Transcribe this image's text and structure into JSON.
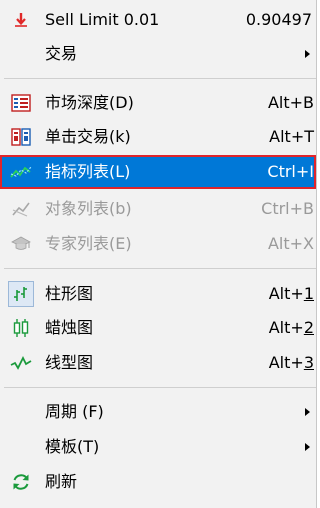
{
  "menu": {
    "items": [
      {
        "label": "Sell Limit 0.01",
        "shortcut": "0.90497"
      },
      {
        "label": "交易",
        "shortcut": ""
      },
      {
        "label": "市场深度(D)",
        "shortcut": "Alt+B"
      },
      {
        "label": "单击交易(k)",
        "shortcut": "Alt+T"
      },
      {
        "label": "指标列表(L)",
        "shortcut": "Ctrl+I"
      },
      {
        "label": "对象列表(b)",
        "shortcut": "Ctrl+B"
      },
      {
        "label": "专家列表(E)",
        "shortcut": "Alt+X"
      },
      {
        "label": "柱形图",
        "shortcut_prefix": "Alt+",
        "shortcut_key": "1"
      },
      {
        "label": "蜡烛图",
        "shortcut_prefix": "Alt+",
        "shortcut_key": "2"
      },
      {
        "label": "线型图",
        "shortcut_prefix": "Alt+",
        "shortcut_key": "3"
      },
      {
        "label": "周期 (F)",
        "shortcut": ""
      },
      {
        "label": "模板(T)",
        "shortcut": ""
      },
      {
        "label": "刷新",
        "shortcut": ""
      }
    ]
  },
  "colors": {
    "selection": "#0078d7",
    "selection_border": "#e0252b",
    "accent_red": "#e02828",
    "accent_green": "#1b9a3c",
    "disabled": "#9a9a9a"
  },
  "icons": {
    "sell_limit": "sell-arrow-icon",
    "market_depth": "market-depth-icon",
    "one_click": "one-click-trading-icon",
    "indicators": "indicator-line-icon",
    "objects": "object-list-icon",
    "experts": "expert-hat-icon",
    "bar_chart": "bar-chart-icon",
    "candle_chart": "candlestick-icon",
    "line_chart": "line-chart-icon",
    "refresh": "refresh-icon"
  }
}
